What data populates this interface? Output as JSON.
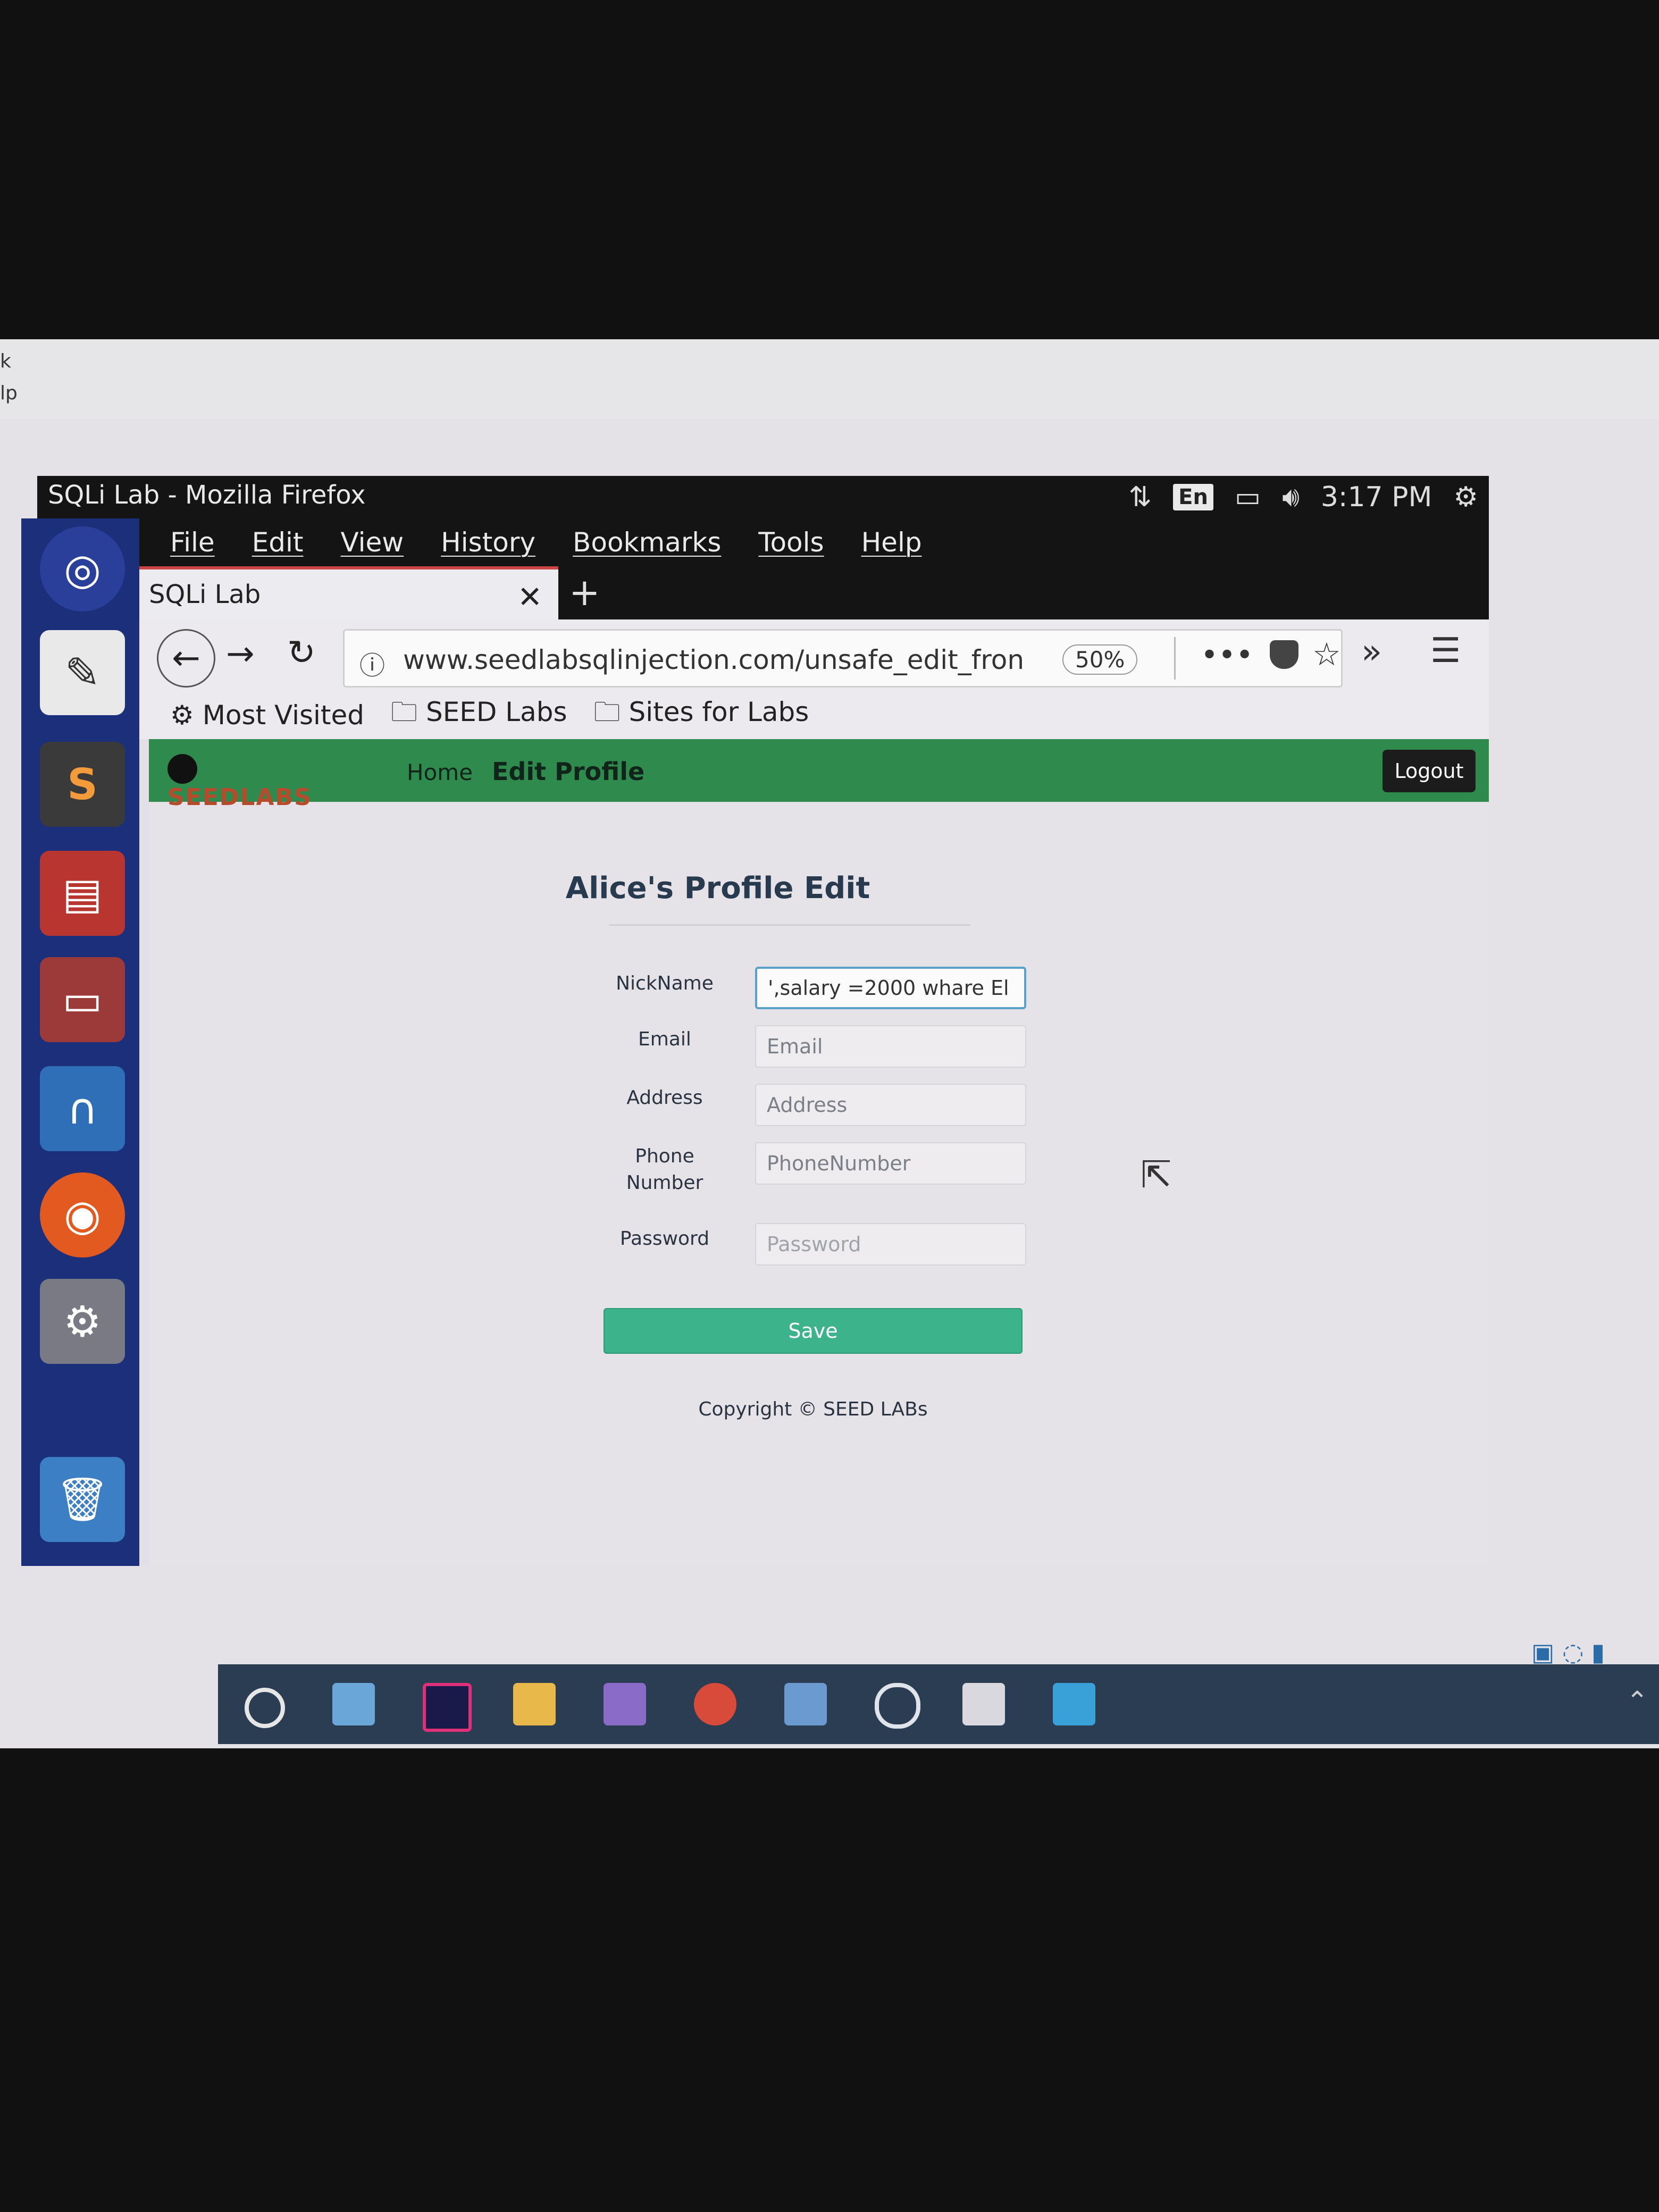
{
  "window": {
    "title": "SQLi Lab - Mozilla Firefox"
  },
  "system_tray": {
    "language": "En",
    "clock": "3:17 PM"
  },
  "host_left_text": [
    "k",
    "lp"
  ],
  "menu": [
    "File",
    "Edit",
    "View",
    "History",
    "Bookmarks",
    "Tools",
    "Help"
  ],
  "tab": {
    "title": "SQLi Lab",
    "close": "✕",
    "new_tab": "+"
  },
  "nav": {
    "url": "www.seedlabsqlinjection.com/unsafe_edit_fron",
    "zoom": "50%"
  },
  "bookmarks": [
    "Most Visited",
    "SEED Labs",
    "Sites for Labs"
  ],
  "site": {
    "logo_text": "SEEDLABS",
    "nav_home": "Home",
    "nav_edit": "Edit Profile",
    "logout": "Logout"
  },
  "form": {
    "title": "Alice's Profile Edit",
    "fields": [
      {
        "label": "NickName",
        "value": "',salary =2000 whare El",
        "placeholder": ""
      },
      {
        "label": "Email",
        "value": "",
        "placeholder": "Email"
      },
      {
        "label": "Address",
        "value": "",
        "placeholder": "Address"
      },
      {
        "label": "Phone Number",
        "value": "",
        "placeholder": "PhoneNumber"
      },
      {
        "label": "Password",
        "value": "",
        "placeholder": "Password"
      }
    ],
    "save": "Save",
    "copyright": "Copyright © SEED LABs"
  },
  "colors": {
    "site_nav_green": "#2f8a4e",
    "save_button": "#3cb38a",
    "launcher_blue": "#1c2f7a",
    "title_text": "#273a4e"
  },
  "icons": {
    "launcher": [
      "ubuntu-dash-icon",
      "text-editor-icon",
      "sublime-text-icon",
      "terminal-icon",
      "file-manager-icon",
      "wireshark-icon",
      "firefox-icon",
      "system-settings-icon",
      "trash-icon"
    ],
    "windows_taskbar": [
      "cortana-search-icon",
      "this-pc-icon",
      "intellij-icon",
      "file-explorer-icon",
      "visual-studio-icon",
      "chrome-icon",
      "virtualbox-icon",
      "media-player-icon",
      "tool-app-icon",
      "photos-icon"
    ]
  }
}
